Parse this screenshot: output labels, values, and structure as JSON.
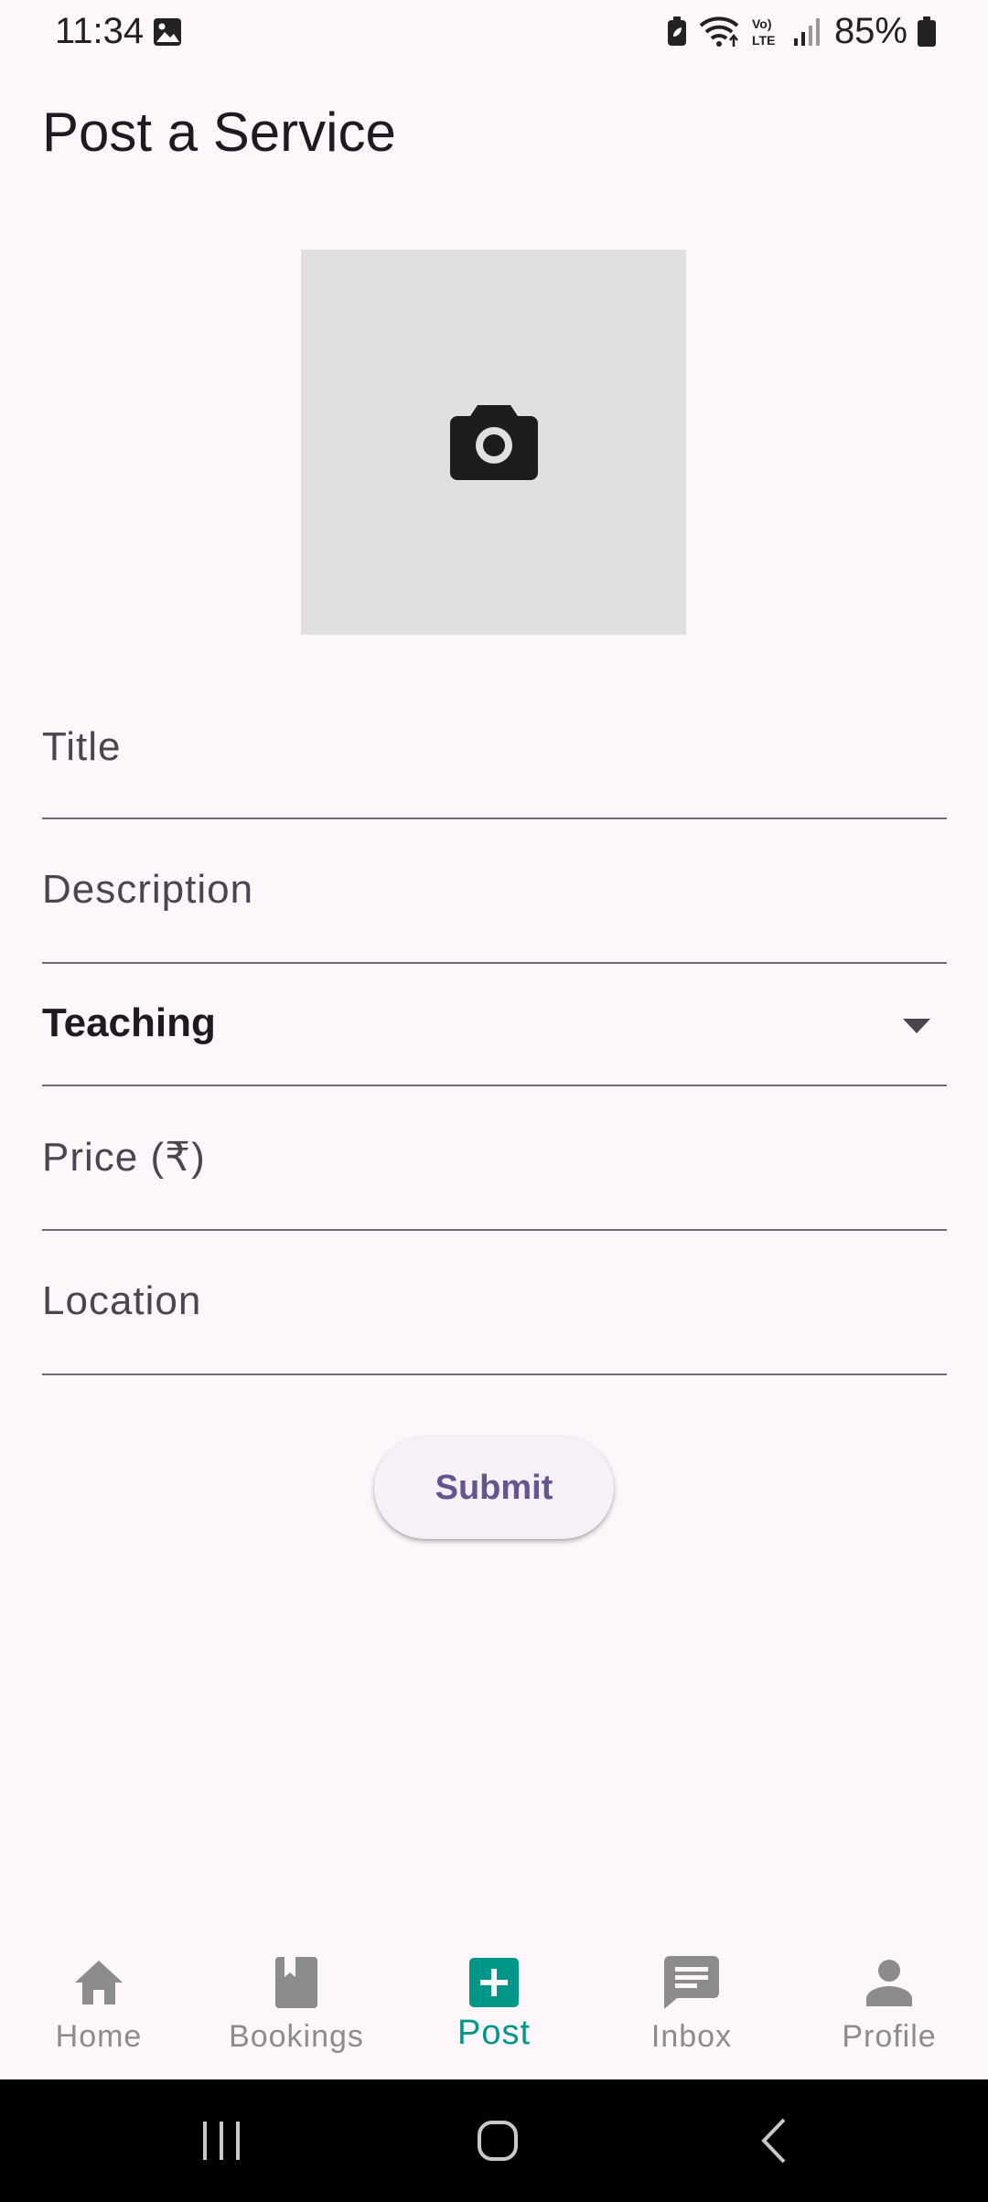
{
  "status_bar": {
    "time": "11:34",
    "battery_percent": "85%",
    "icons": [
      "gallery-icon",
      "battery-saver-icon",
      "wifi-icon",
      "volte-icon",
      "signal-icon",
      "battery-icon"
    ]
  },
  "page": {
    "title": "Post a Service"
  },
  "photo_picker": {
    "icon": "camera-icon"
  },
  "form": {
    "title_label": "Title",
    "description_label": "Description",
    "category_value": "Teaching",
    "price_label": "Price (₹)",
    "location_label": "Location",
    "submit_label": "Submit"
  },
  "bottom_nav": {
    "items": [
      {
        "label": "Home",
        "icon": "home-icon",
        "active": false
      },
      {
        "label": "Bookings",
        "icon": "book-icon",
        "active": false
      },
      {
        "label": "Post",
        "icon": "add-box-icon",
        "active": true
      },
      {
        "label": "Inbox",
        "icon": "chat-icon",
        "active": false
      },
      {
        "label": "Profile",
        "icon": "person-icon",
        "active": false
      }
    ]
  },
  "colors": {
    "background": "#FDF7FC",
    "accent": "#009688",
    "button_text": "#65558F",
    "inactive_nav": "#8C8C8C",
    "photo_placeholder": "#E0E0E0"
  }
}
